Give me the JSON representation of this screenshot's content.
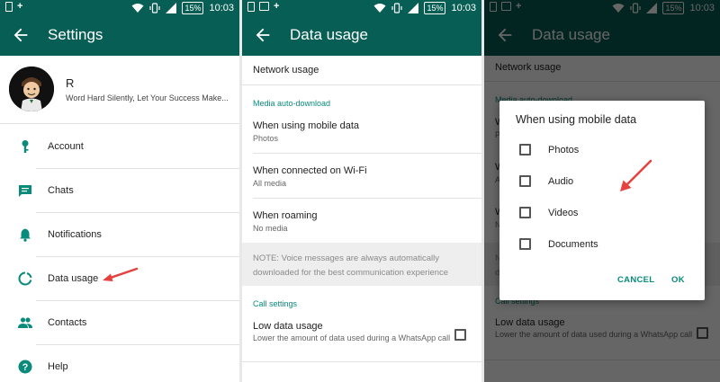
{
  "status_bar": {
    "battery": "15%",
    "time": "10:03"
  },
  "settings_screen": {
    "title": "Settings",
    "profile": {
      "name": "R",
      "status": "Word Hard Silently, Let Your Success Make..."
    },
    "items": [
      {
        "label": "Account",
        "icon": "key-icon"
      },
      {
        "label": "Chats",
        "icon": "chat-icon"
      },
      {
        "label": "Notifications",
        "icon": "bell-icon"
      },
      {
        "label": "Data usage",
        "icon": "data-usage-icon"
      },
      {
        "label": "Contacts",
        "icon": "contacts-icon"
      },
      {
        "label": "Help",
        "icon": "help-icon"
      }
    ]
  },
  "data_usage_screen": {
    "title": "Data usage",
    "network_usage": "Network usage",
    "media_section": "Media auto-download",
    "mobile": {
      "title": "When using mobile data",
      "value": "Photos"
    },
    "wifi": {
      "title": "When connected on Wi-Fi",
      "value": "All media"
    },
    "roaming": {
      "title": "When roaming",
      "value": "No media"
    },
    "note": "NOTE: Voice messages are always automatically downloaded for the best communication experience",
    "call_section": "Call settings",
    "low_data": {
      "title": "Low data usage",
      "subtitle": "Lower the amount of data used during a WhatsApp call"
    }
  },
  "dialog": {
    "title": "When using mobile data",
    "options": [
      "Photos",
      "Audio",
      "Videos",
      "Documents"
    ],
    "cancel": "CANCEL",
    "ok": "OK"
  },
  "colors": {
    "primary": "#075e54",
    "accent": "#098b7b",
    "arrow": "#e5413f"
  }
}
